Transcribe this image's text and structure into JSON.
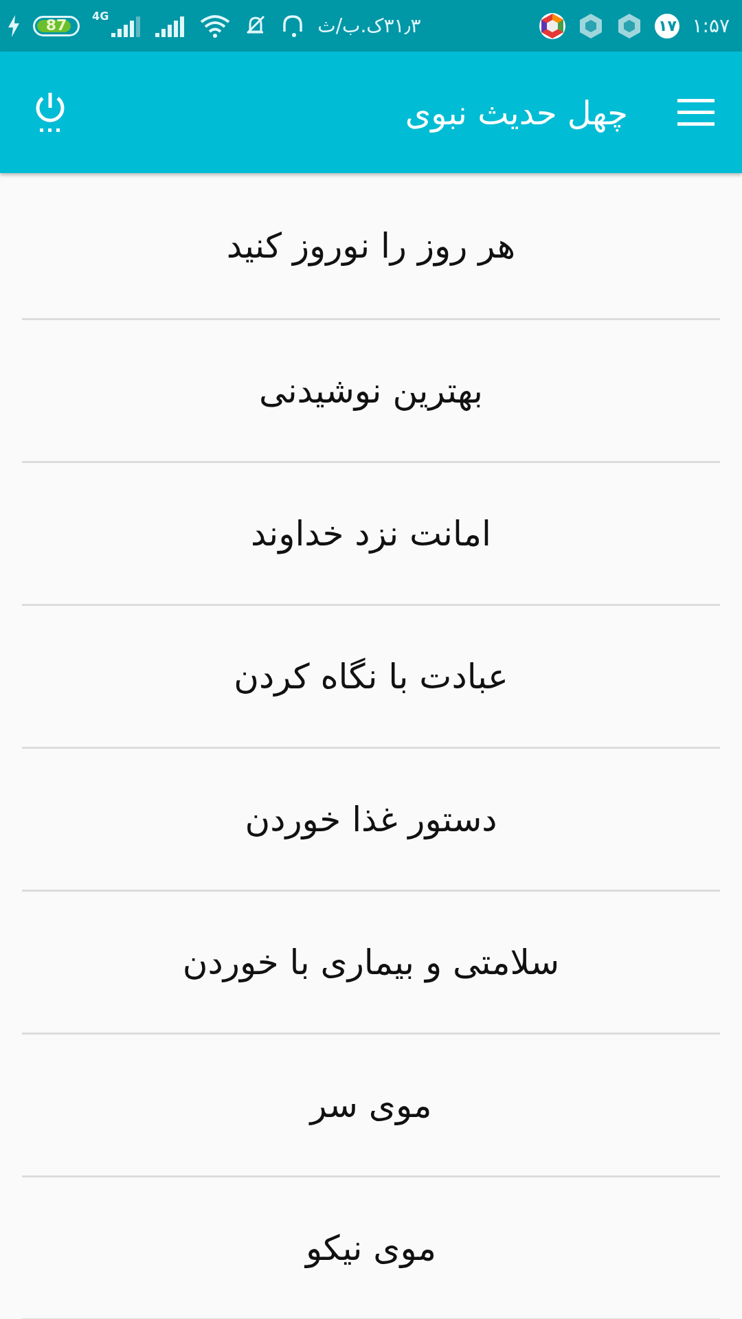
{
  "status_bar": {
    "time": "۱:۵۷",
    "notification_count": "۱۷",
    "network_speed": "۳۱٫۳ک.ب/ث",
    "battery": {
      "text": "87",
      "level": 0.87,
      "charging": true
    },
    "network_type": "4G"
  },
  "app_bar": {
    "title": "چهل حدیث نبوی"
  },
  "items": [
    {
      "label": "هر روز را نوروز کنید"
    },
    {
      "label": "بهترین نوشیدنی"
    },
    {
      "label": "امانت نزد خداوند"
    },
    {
      "label": "عبادت با نگاه کردن"
    },
    {
      "label": "دستور غذا خوردن"
    },
    {
      "label": "سلامتی و بیماری با خوردن"
    },
    {
      "label": "موی سر"
    },
    {
      "label": "موی نیکو"
    }
  ]
}
